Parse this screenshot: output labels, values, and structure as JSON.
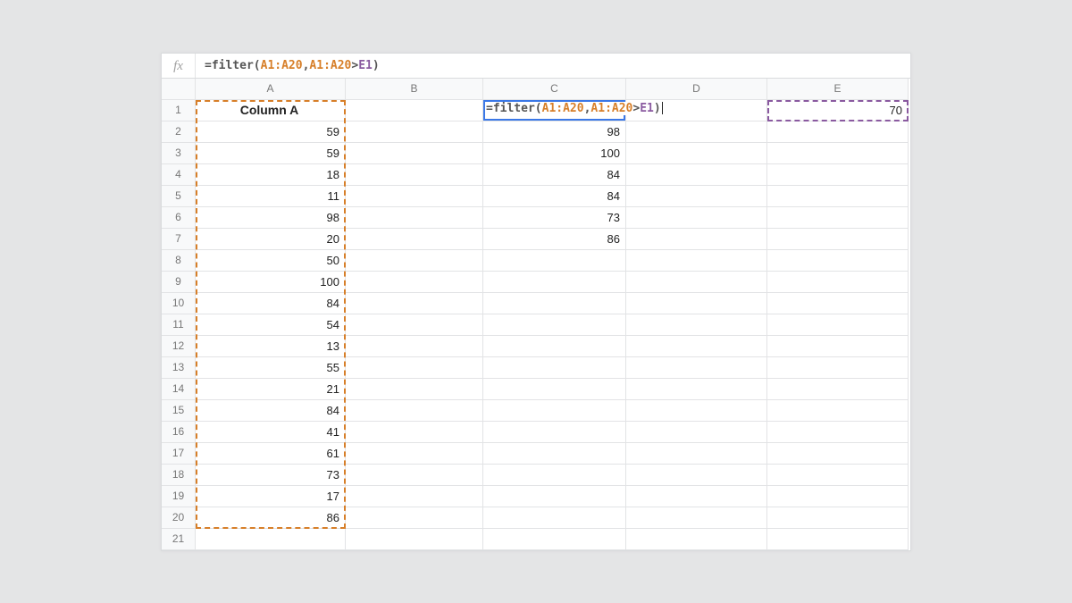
{
  "formula_bar": {
    "fx_label": "fx",
    "eq": "=",
    "fn": "filter",
    "open": "(",
    "ref1a": "A1:A20",
    "comma": ",",
    "ref1b": "A1:A20",
    "gt": ">",
    "ref2": "E1",
    "close": ")"
  },
  "columns": [
    "A",
    "B",
    "C",
    "D",
    "E"
  ],
  "row_count": 21,
  "cells": {
    "A1": "Column A",
    "A2": "59",
    "A3": "59",
    "A4": "18",
    "A5": "11",
    "A6": "98",
    "A7": "20",
    "A8": "50",
    "A9": "100",
    "A10": "84",
    "A11": "54",
    "A12": "13",
    "A13": "55",
    "A14": "21",
    "A15": "84",
    "A16": "41",
    "A17": "61",
    "A18": "73",
    "A19": "17",
    "A20": "86",
    "C2": "98",
    "C3": "100",
    "C4": "84",
    "C5": "84",
    "C6": "73",
    "C7": "86",
    "E1": "70"
  },
  "active_formula": {
    "eq": "=",
    "fn": "filter",
    "open": "(",
    "ref1a": "A1:A20",
    "comma": ",",
    "ref1b": "A1:A20",
    "gt": ">",
    "ref2": "E1",
    "close": ")"
  },
  "colors": {
    "range1": "#d77f29",
    "range2": "#8a5aa0",
    "selection": "#3b78e7"
  }
}
